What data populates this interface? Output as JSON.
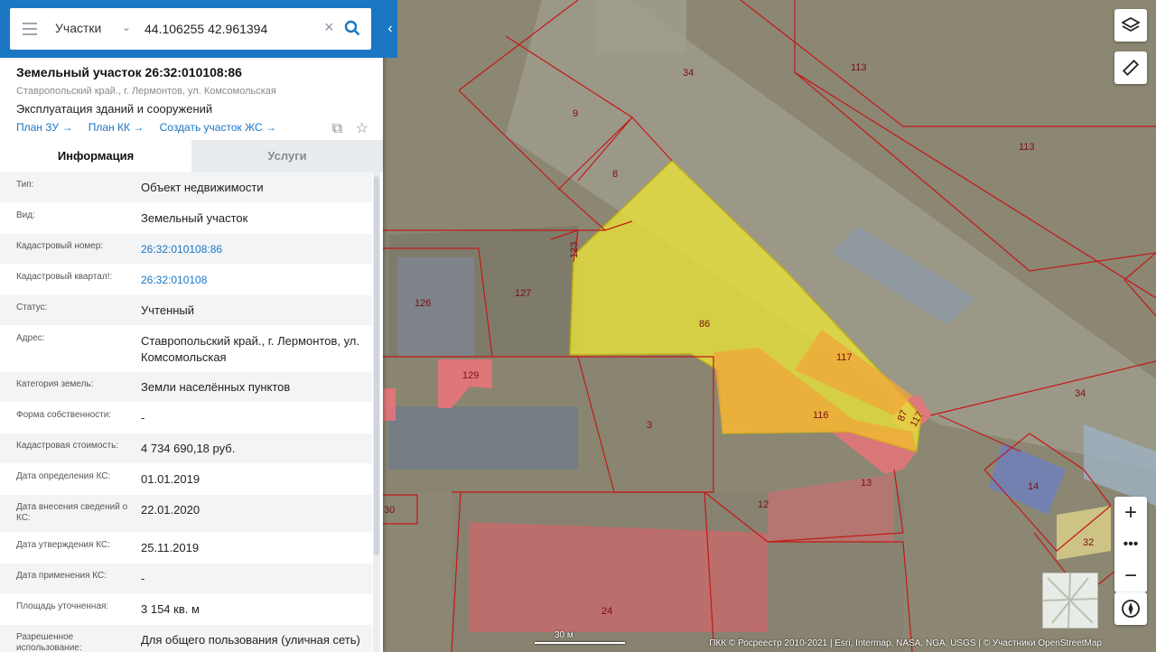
{
  "search": {
    "type_label": "Участки",
    "query": "44.106255 42.961394"
  },
  "object": {
    "title": "Земельный участок 26:32:010108:86",
    "address": "Ставропольский край., г. Лермонтов, ул. Комсомольская",
    "usage": "Эксплуатация зданий и сооружений",
    "links": [
      "План ЗУ →",
      "План КК →",
      "Создать участок ЖС →"
    ]
  },
  "tabs": [
    "Информация",
    "Услуги"
  ],
  "info_rows": [
    {
      "label": "Тип:",
      "value": "Объект недвижимости"
    },
    {
      "label": "Вид:",
      "value": "Земельный участок"
    },
    {
      "label": "Кадастровый номер:",
      "value": "26:32:010108:86",
      "link": true
    },
    {
      "label": "Кадастровый квартал!:",
      "value": "26:32:010108",
      "link": true
    },
    {
      "label": "Статус:",
      "value": "Учтенный"
    },
    {
      "label": "Адрес:",
      "value": "Ставропольский край., г. Лермонтов, ул. Комсомольская"
    },
    {
      "label": "Категория земель:",
      "value": "Земли населённых пунктов"
    },
    {
      "label": "Форма собственности:",
      "value": "-"
    },
    {
      "label": "Кадастровая стоимость:",
      "value": "4 734 690,18 руб."
    },
    {
      "label": "Дата определения КС:",
      "value": "01.01.2019"
    },
    {
      "label": "Дата внесения сведений о КС:",
      "value": "22.01.2020"
    },
    {
      "label": "Дата утверждения КС:",
      "value": "25.11.2019"
    },
    {
      "label": "Дата применения КС:",
      "value": "-"
    },
    {
      "label": "Площадь уточненная:",
      "value": "3 154 кв. м"
    },
    {
      "label": "Разрешенное использование:",
      "value": "Для общего пользования (уличная сеть)"
    }
  ],
  "map": {
    "parcel_labels": [
      "34",
      "113",
      "9",
      "113",
      "8",
      "123",
      "127",
      "126",
      "86",
      "117",
      "129",
      "116",
      "87",
      "117",
      "34",
      "3",
      "13",
      "12",
      "14",
      "30",
      "32",
      "24"
    ],
    "scale_label": "30 м",
    "attribution": "ПКК © Росреестр 2010-2021 | Esri, Intermap, NASA, NGA, USGS | © Участники OpenStreetMap",
    "colors": {
      "selected": "#e8e23a",
      "adjacent": "#f0a53a",
      "plot_border": "#c41818",
      "pink_plot": "#e8747a"
    }
  }
}
